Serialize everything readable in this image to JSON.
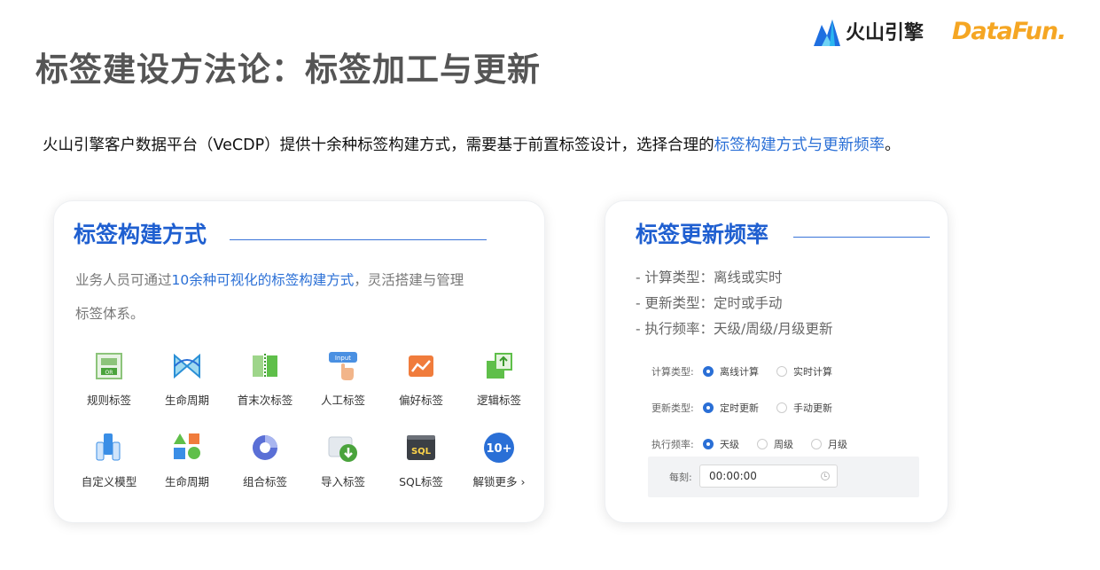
{
  "slide": {
    "title": "标签建设方法论：标签加工与更新"
  },
  "logos": {
    "volc_text": "火山引擎",
    "datafun_text": "DataFun."
  },
  "intro": {
    "prefix": "火山引擎客户数据平台（VeCDP）提供十余种标签构建方式，需要基于前置标签设计，选择合理的",
    "highlight": "标签构建方式与更新频率",
    "suffix": "。"
  },
  "left_card": {
    "title": "标签构建方式",
    "desc_prefix": "业务人员可通过",
    "desc_highlight": "10余种可视化的标签构建方式",
    "desc_suffix": "，灵活搭建与管理",
    "desc_line2": "标签体系。",
    "tiles": [
      {
        "label": "规则标签",
        "icon": "rule-tag-icon"
      },
      {
        "label": "生命周期",
        "icon": "lifecycle-flow-icon"
      },
      {
        "label": "首末次标签",
        "icon": "first-last-tag-icon"
      },
      {
        "label": "人工标签",
        "icon": "manual-input-icon"
      },
      {
        "label": "偏好标签",
        "icon": "preference-chart-icon"
      },
      {
        "label": "逻辑标签",
        "icon": "logic-tag-icon"
      },
      {
        "label": "自定义模型",
        "icon": "custom-model-icon"
      },
      {
        "label": "生命周期",
        "icon": "lifecycle-shapes-icon"
      },
      {
        "label": "组合标签",
        "icon": "combine-tag-icon"
      },
      {
        "label": "导入标签",
        "icon": "import-tag-icon"
      },
      {
        "label": "SQL标签",
        "icon": "sql-tag-icon"
      },
      {
        "label": "解锁更多 ›",
        "icon": "more-icon",
        "badge": "10+"
      }
    ]
  },
  "right_card": {
    "title": "标签更新频率",
    "list": [
      "- 计算类型：离线或实时",
      "- 更新类型：定时或手动",
      "- 执行频率：天级/周级/月级更新"
    ],
    "form": {
      "calc_label": "计算类型:",
      "calc_options": [
        "离线计算",
        "实时计算"
      ],
      "update_label": "更新类型:",
      "update_options": [
        "定时更新",
        "手动更新"
      ],
      "freq_label": "执行频率:",
      "freq_options": [
        "天级",
        "周级",
        "月级"
      ],
      "time_label": "每刻:",
      "time_value": "00:00:00"
    }
  },
  "colors": {
    "accent": "#2a6fd6",
    "title_gray": "#555555",
    "datafun_orange": "#f5a623"
  }
}
